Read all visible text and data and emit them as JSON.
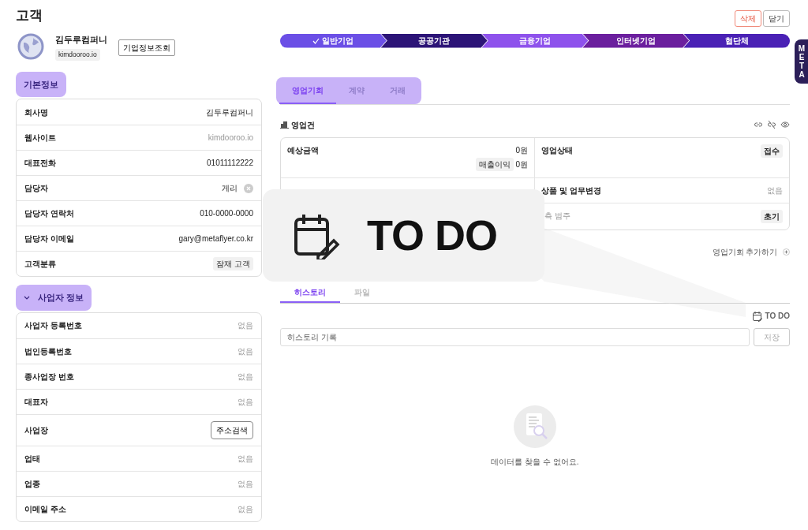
{
  "page_title": "고객",
  "header_buttons": [
    {
      "label": "삭제",
      "kind": "danger"
    },
    {
      "label": "닫기",
      "kind": "plain"
    }
  ],
  "company": {
    "name": "김두루컴퍼니",
    "domain": "kimdooroo.io",
    "lookup_button": "기업정보조회"
  },
  "stages": [
    {
      "label": "일반기업",
      "done": true,
      "color": "#6b4fe6"
    },
    {
      "label": "공공기관",
      "done": false,
      "color": "#2c1477"
    },
    {
      "label": "금융기업",
      "done": false,
      "color": "#8e52ec"
    },
    {
      "label": "인터넷기업",
      "done": false,
      "color": "#6b1f9e"
    },
    {
      "label": "협단체",
      "done": false,
      "color": "#4a21b5"
    }
  ],
  "side_tab": "META",
  "basic_info": {
    "title": "기본정보",
    "rows": [
      {
        "label": "회사명",
        "value": "김두루컴퍼니",
        "kind": "text"
      },
      {
        "label": "웹사이트",
        "value": "kimdooroo.io",
        "kind": "muted"
      },
      {
        "label": "대표전화",
        "value": "01011112222",
        "kind": "text"
      },
      {
        "label": "담당자",
        "value": "게리",
        "kind": "person"
      },
      {
        "label": "담당자 연락처",
        "value": "010-0000-0000",
        "kind": "text"
      },
      {
        "label": "담당자 이메일",
        "value": "gary@metaflyer.co.kr",
        "kind": "text"
      },
      {
        "label": "고객분류",
        "value": "잠재 고객",
        "kind": "badge"
      }
    ]
  },
  "business_info": {
    "title": "사업자 정보",
    "expanded": true,
    "rows": [
      {
        "label": "사업자 등록번호",
        "value": "없음",
        "kind": "muted"
      },
      {
        "label": "법인등록번호",
        "value": "없음",
        "kind": "muted"
      },
      {
        "label": "종사업장 번호",
        "value": "없음",
        "kind": "muted"
      },
      {
        "label": "대표자",
        "value": "없음",
        "kind": "muted"
      },
      {
        "label": "사업장",
        "value": "주소검색",
        "kind": "button"
      },
      {
        "label": "업태",
        "value": "없음",
        "kind": "muted"
      },
      {
        "label": "업종",
        "value": "없음",
        "kind": "muted"
      },
      {
        "label": "이메일 주소",
        "value": "없음",
        "kind": "muted"
      }
    ]
  },
  "tabs": [
    {
      "label": "영업기회",
      "selected": true
    },
    {
      "label": "계약",
      "selected": false
    },
    {
      "label": "거래",
      "selected": false
    }
  ],
  "deal": {
    "title": "영업건",
    "cells": [
      {
        "label": "예상금액",
        "value": "0원",
        "badge": "매출이익",
        "sub_value": "0원",
        "kind": "amount"
      },
      {
        "label": "영업상태",
        "value": "접수",
        "kind": "badge"
      },
      {
        "kind": "hidden"
      },
      {
        "label": "상품 및 업무변경",
        "value": "없음",
        "kind": "muted"
      },
      {
        "kind": "hidden"
      },
      {
        "label": "측 범주",
        "value": "초기",
        "kind": "faded-badge"
      }
    ],
    "add_link": "영업기회 추가하기"
  },
  "history_tabs": [
    {
      "label": "히스토리",
      "selected": true
    },
    {
      "label": "파일",
      "selected": false
    }
  ],
  "todo_button": "TO DO",
  "history_input": {
    "placeholder": "히스토리 기록"
  },
  "save_button": {
    "label": "저장",
    "disabled": true
  },
  "empty_message": "데이터를 찾을 수 없어요.",
  "callout": {
    "text": "TO DO"
  }
}
